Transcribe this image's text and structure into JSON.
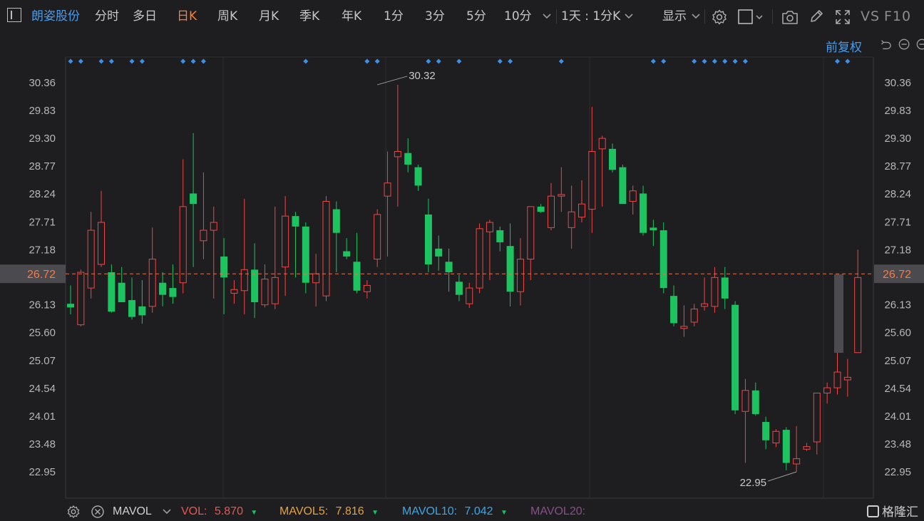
{
  "toolbar": {
    "stock_name": "朗姿股份",
    "periods": [
      "分时",
      "多日",
      "日K",
      "周K",
      "月K",
      "季K",
      "年K",
      "1分",
      "3分",
      "5分",
      "10分"
    ],
    "active_period": "日K",
    "interval_select": "1天 : 1分K",
    "display_label": "显示",
    "vs_label": "VS",
    "f10_label": "F10"
  },
  "adjust_label": "前复权",
  "price_axis": [
    "30.36",
    "29.83",
    "29.30",
    "28.77",
    "28.24",
    "27.71",
    "27.18",
    "26.72",
    "26.13",
    "25.60",
    "25.07",
    "24.54",
    "24.01",
    "23.48",
    "22.95"
  ],
  "current_price": "26.72",
  "annotations": {
    "high": "30.32",
    "low": "22.95"
  },
  "colors": {
    "up": "#f04646",
    "down": "#1cc35f",
    "current_line": "#e8704a",
    "accent": "#4a9bea",
    "marker": "#3d8fe8"
  },
  "chart_data": {
    "type": "candlestick",
    "ohlc": [
      [
        26.15,
        26.5,
        25.95,
        26.08
      ],
      [
        25.75,
        26.8,
        25.72,
        26.75
      ],
      [
        26.45,
        27.9,
        26.25,
        27.55
      ],
      [
        26.9,
        28.3,
        26.85,
        27.7
      ],
      [
        26.75,
        26.9,
        25.98,
        26.0
      ],
      [
        26.55,
        26.85,
        26.2,
        26.18
      ],
      [
        26.22,
        26.65,
        25.85,
        25.9
      ],
      [
        26.1,
        26.6,
        25.77,
        25.93
      ],
      [
        26.1,
        27.6,
        25.98,
        27.0
      ],
      [
        26.55,
        26.75,
        26.1,
        26.32
      ],
      [
        26.45,
        26.9,
        26.15,
        26.28
      ],
      [
        26.55,
        28.9,
        26.35,
        28.0
      ],
      [
        28.25,
        29.4,
        26.85,
        28.05
      ],
      [
        27.35,
        28.65,
        27.0,
        27.55
      ],
      [
        27.55,
        28.0,
        26.25,
        27.7
      ],
      [
        27.05,
        27.4,
        25.95,
        26.65
      ],
      [
        26.35,
        26.6,
        26.15,
        26.42
      ],
      [
        26.4,
        28.15,
        25.95,
        26.8
      ],
      [
        26.8,
        27.3,
        25.88,
        26.18
      ],
      [
        26.13,
        26.9,
        26.08,
        26.62
      ],
      [
        26.15,
        28.0,
        26.05,
        26.65
      ],
      [
        26.85,
        28.2,
        26.3,
        27.82
      ],
      [
        27.82,
        27.9,
        26.65,
        27.62
      ],
      [
        27.62,
        27.7,
        26.35,
        26.55
      ],
      [
        26.55,
        27.1,
        26.1,
        26.72
      ],
      [
        26.3,
        28.2,
        26.2,
        28.1
      ],
      [
        27.95,
        28.1,
        26.75,
        27.5
      ],
      [
        27.15,
        27.4,
        27.0,
        27.05
      ],
      [
        26.95,
        27.5,
        26.35,
        26.4
      ],
      [
        26.38,
        26.6,
        26.25,
        26.5
      ],
      [
        27.0,
        27.95,
        26.85,
        27.85
      ],
      [
        28.2,
        29.05,
        27.05,
        28.45
      ],
      [
        28.95,
        30.32,
        28.0,
        29.05
      ],
      [
        29.02,
        29.3,
        28.65,
        28.8
      ],
      [
        28.75,
        28.8,
        28.3,
        28.4
      ],
      [
        27.85,
        28.15,
        26.75,
        26.9
      ],
      [
        27.2,
        27.45,
        26.78,
        27.05
      ],
      [
        26.95,
        27.2,
        26.38,
        26.75
      ],
      [
        26.57,
        26.7,
        26.2,
        26.32
      ],
      [
        26.15,
        26.55,
        26.07,
        26.45
      ],
      [
        26.45,
        27.68,
        26.35,
        27.58
      ],
      [
        27.52,
        27.75,
        26.6,
        27.7
      ],
      [
        27.55,
        27.62,
        27.15,
        27.32
      ],
      [
        27.25,
        27.68,
        26.1,
        26.38
      ],
      [
        26.38,
        27.4,
        26.12,
        27.0
      ],
      [
        27.0,
        28.0,
        26.6,
        28.0
      ],
      [
        28.0,
        28.05,
        27.88,
        27.9
      ],
      [
        27.6,
        28.45,
        27.55,
        28.2
      ],
      [
        28.2,
        28.75,
        27.9,
        28.23
      ],
      [
        27.6,
        28.4,
        27.2,
        27.9
      ],
      [
        27.8,
        28.5,
        27.7,
        28.05
      ],
      [
        27.95,
        29.9,
        27.5,
        29.05
      ],
      [
        29.1,
        29.35,
        28.0,
        29.3
      ],
      [
        29.1,
        29.2,
        28.65,
        28.7
      ],
      [
        28.75,
        28.8,
        28.05,
        28.05
      ],
      [
        28.1,
        28.4,
        27.85,
        28.3
      ],
      [
        28.25,
        28.4,
        27.45,
        27.5
      ],
      [
        27.6,
        27.75,
        27.25,
        27.55
      ],
      [
        27.55,
        27.7,
        26.35,
        26.45
      ],
      [
        26.3,
        26.5,
        25.72,
        25.78
      ],
      [
        25.68,
        26.12,
        25.52,
        25.72
      ],
      [
        25.8,
        26.15,
        25.72,
        26.05
      ],
      [
        26.1,
        26.65,
        26.02,
        26.15
      ],
      [
        26.1,
        26.85,
        25.98,
        26.65
      ],
      [
        26.65,
        26.85,
        26.05,
        26.25
      ],
      [
        26.13,
        26.2,
        24.05,
        24.12
      ],
      [
        24.1,
        24.72,
        23.12,
        24.5
      ],
      [
        24.5,
        24.65,
        24.02,
        24.05
      ],
      [
        23.9,
        24.0,
        23.38,
        23.55
      ],
      [
        23.5,
        23.76,
        23.42,
        23.72
      ],
      [
        23.75,
        23.8,
        22.98,
        23.12
      ],
      [
        23.1,
        23.82,
        22.95,
        23.2
      ],
      [
        23.38,
        23.5,
        23.35,
        23.43
      ],
      [
        23.52,
        24.42,
        23.28,
        24.45
      ],
      [
        24.45,
        24.65,
        24.25,
        24.55
      ],
      [
        24.55,
        25.3,
        24.42,
        24.85
      ],
      [
        24.7,
        25.1,
        24.38,
        24.75
      ],
      [
        25.22,
        27.18,
        25.22,
        26.65
      ]
    ]
  },
  "bottom": {
    "indicator": "MAVOL",
    "vol_label": "VOL:",
    "vol_value": "5.870",
    "mavol5_label": "MAVOL5:",
    "mavol5_value": "7.816",
    "mavol10_label": "MAVOL10:",
    "mavol10_value": "7.042",
    "mavol20_label": "MAVOL20:"
  },
  "logo_text": "格隆汇"
}
